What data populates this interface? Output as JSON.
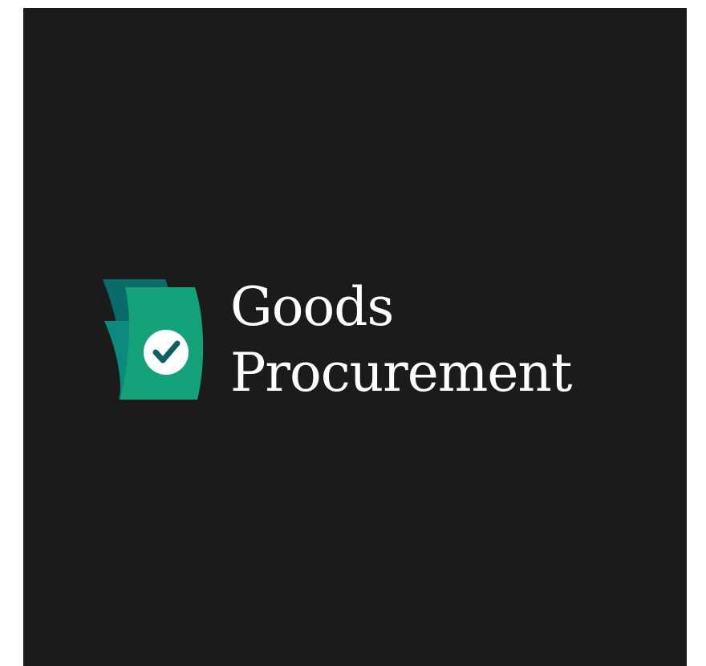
{
  "brand": {
    "line1": "Goods",
    "line2": "Procurement",
    "colors": {
      "background": "#1b1b1b",
      "text": "#ffffff",
      "sheet_back": "#0a6b6a",
      "sheet_mid": "#0d8a7f",
      "sheet_front": "#13a27a",
      "check_circle": "#ffffff",
      "check_mark": "#0c5f63"
    },
    "icon": "document-check-icon"
  }
}
